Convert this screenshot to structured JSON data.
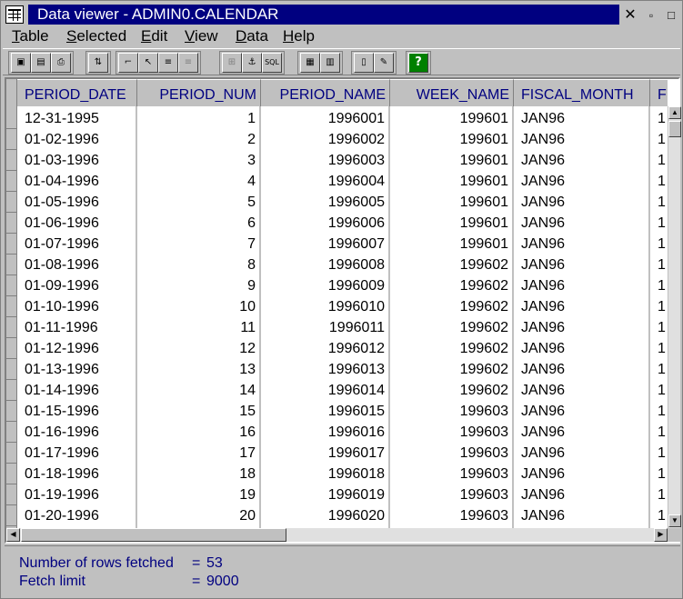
{
  "window": {
    "title": "Data viewer - ADMIN0.CALENDAR",
    "close_glyph": "✕",
    "restore_glyph": "▫",
    "maximize_glyph": "□"
  },
  "menu": {
    "items": [
      {
        "label": "Table",
        "accel": "T"
      },
      {
        "label": "Selected",
        "accel": "S"
      },
      {
        "label": "Edit",
        "accel": "E"
      },
      {
        "label": "View",
        "accel": "V"
      },
      {
        "label": "Data",
        "accel": "D"
      },
      {
        "label": "Help",
        "accel": "H"
      }
    ]
  },
  "toolbar": {
    "buttons": [
      {
        "icon": "save-icon",
        "glyph": "▣",
        "enabled": true
      },
      {
        "icon": "open-icon",
        "glyph": "▤",
        "enabled": true
      },
      {
        "icon": "print-icon",
        "glyph": "⎙",
        "enabled": true
      },
      {
        "icon": "sort-icon",
        "glyph": "⇅",
        "enabled": true
      },
      {
        "icon": "filter-icon",
        "glyph": "⌐",
        "enabled": true
      },
      {
        "icon": "select-icon",
        "glyph": "↖",
        "enabled": true
      },
      {
        "icon": "edit-row-icon",
        "glyph": "≡",
        "enabled": true
      },
      {
        "icon": "insert-row-icon",
        "glyph": "≡",
        "enabled": false
      },
      {
        "icon": "join-icon",
        "glyph": "⊞",
        "enabled": false
      },
      {
        "icon": "anchor-icon",
        "glyph": "⚓",
        "enabled": true
      },
      {
        "icon": "sql-icon",
        "glyph": "SQL",
        "enabled": true
      },
      {
        "icon": "grid-view-icon",
        "glyph": "▦",
        "enabled": true
      },
      {
        "icon": "form-view-icon",
        "glyph": "▥",
        "enabled": true
      },
      {
        "icon": "book-icon",
        "glyph": "▯",
        "enabled": true
      },
      {
        "icon": "pencil-icon",
        "glyph": "✎",
        "enabled": true
      },
      {
        "icon": "help-icon",
        "glyph": "?",
        "enabled": true
      }
    ]
  },
  "grid": {
    "columns": [
      {
        "name": "PERIOD_DATE",
        "align": "left"
      },
      {
        "name": "PERIOD_NUM",
        "align": "right"
      },
      {
        "name": "PERIOD_NAME",
        "align": "right"
      },
      {
        "name": "WEEK_NAME",
        "align": "right"
      },
      {
        "name": "FISCAL_MONTH",
        "align": "left"
      },
      {
        "name": "F",
        "align": "left"
      }
    ],
    "rows": [
      [
        "12-31-1995",
        "1",
        "1996001",
        "199601",
        "JAN96",
        "1"
      ],
      [
        "01-02-1996",
        "2",
        "1996002",
        "199601",
        "JAN96",
        "1"
      ],
      [
        "01-03-1996",
        "3",
        "1996003",
        "199601",
        "JAN96",
        "1"
      ],
      [
        "01-04-1996",
        "4",
        "1996004",
        "199601",
        "JAN96",
        "1"
      ],
      [
        "01-05-1996",
        "5",
        "1996005",
        "199601",
        "JAN96",
        "1"
      ],
      [
        "01-06-1996",
        "6",
        "1996006",
        "199601",
        "JAN96",
        "1"
      ],
      [
        "01-07-1996",
        "7",
        "1996007",
        "199601",
        "JAN96",
        "1"
      ],
      [
        "01-08-1996",
        "8",
        "1996008",
        "199602",
        "JAN96",
        "1"
      ],
      [
        "01-09-1996",
        "9",
        "1996009",
        "199602",
        "JAN96",
        "1"
      ],
      [
        "01-10-1996",
        "10",
        "1996010",
        "199602",
        "JAN96",
        "1"
      ],
      [
        "01-11-1996",
        "11",
        "1996011",
        "199602",
        "JAN96",
        "1"
      ],
      [
        "01-12-1996",
        "12",
        "1996012",
        "199602",
        "JAN96",
        "1"
      ],
      [
        "01-13-1996",
        "13",
        "1996013",
        "199602",
        "JAN96",
        "1"
      ],
      [
        "01-14-1996",
        "14",
        "1996014",
        "199602",
        "JAN96",
        "1"
      ],
      [
        "01-15-1996",
        "15",
        "1996015",
        "199603",
        "JAN96",
        "1"
      ],
      [
        "01-16-1996",
        "16",
        "1996016",
        "199603",
        "JAN96",
        "1"
      ],
      [
        "01-17-1996",
        "17",
        "1996017",
        "199603",
        "JAN96",
        "1"
      ],
      [
        "01-18-1996",
        "18",
        "1996018",
        "199603",
        "JAN96",
        "1"
      ],
      [
        "01-19-1996",
        "19",
        "1996019",
        "199603",
        "JAN96",
        "1"
      ],
      [
        "01-20-1996",
        "20",
        "1996020",
        "199603",
        "JAN96",
        "1"
      ]
    ]
  },
  "status": {
    "rows_fetched_label": "Number of rows fetched",
    "rows_fetched_value": "53",
    "fetch_limit_label": "Fetch limit",
    "fetch_limit_value": "9000",
    "equals": "="
  },
  "scroll_glyphs": {
    "up": "▲",
    "down": "▼",
    "left": "◀",
    "right": "▶"
  },
  "colors": {
    "title_bar": "#000080",
    "header_text": "#000080",
    "status_text": "#000080"
  }
}
